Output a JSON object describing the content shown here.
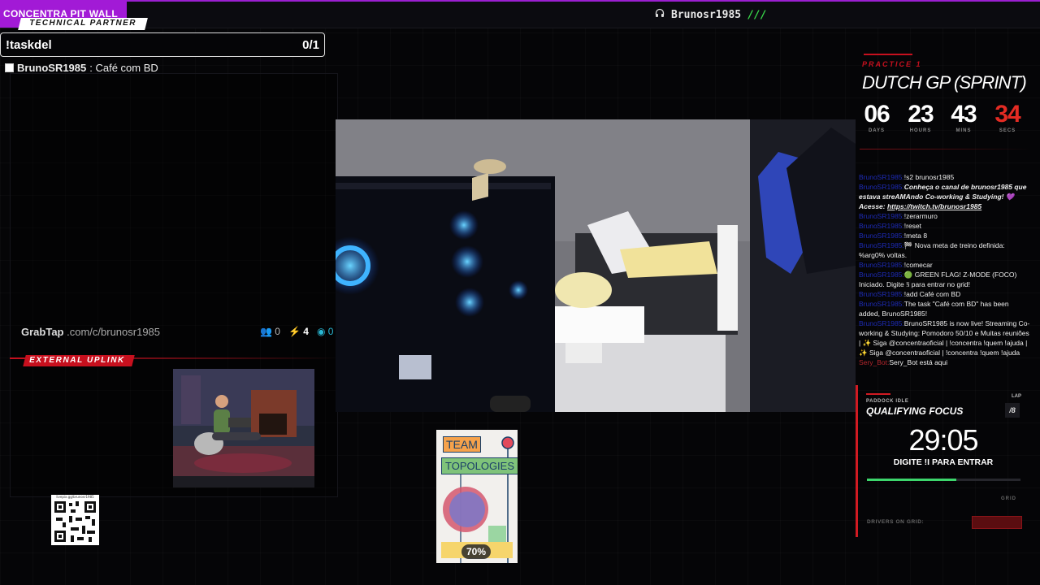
{
  "brand": {
    "title": "CONCENTRA PIT WALL"
  },
  "header": {
    "channel": "Brunosr1985",
    "slashes": "///",
    "icon": "headphones-icon"
  },
  "task_panel": {
    "label": "TECHNICAL PARTNER",
    "command": "!taskdel",
    "count": "0/1",
    "tasks": [
      {
        "user": "BrunoSR1985",
        "text": ": Café com BD"
      }
    ]
  },
  "grabtap": {
    "logo": "GrabTap",
    "url": ".com/c/brunosr1985",
    "users": "0",
    "bolts": "4",
    "viewers": "0"
  },
  "uplink": {
    "label": "EXTERNAL UPLINK"
  },
  "qr": {
    "caption": "livepix.gg/brunosr1985"
  },
  "book": {
    "title_1": "TEAM",
    "title_2": "TOPOLOGIES",
    "progress": "70%",
    "progress_value": 0.7
  },
  "race": {
    "session": "PRACTICE 1",
    "title": "DUTCH GP (SPRINT)",
    "countdown": [
      {
        "value": "06",
        "unit": "DAYS"
      },
      {
        "value": "23",
        "unit": "HOURS"
      },
      {
        "value": "43",
        "unit": "MINS"
      },
      {
        "value": "34",
        "unit": "SECS"
      }
    ]
  },
  "chat": [
    {
      "user": "BrunoSR1985:",
      "text": "!s2 brunosr1985"
    },
    {
      "user": "BrunoSR1985:",
      "text": "Conheça o canal de brunosr1985 que estava streAMAndo Co-working & Studying! 💜 ",
      "emph": true,
      "link_label": "Acesse: ",
      "link": "https://twitch.tv/brunosr1985"
    },
    {
      "user": "BrunoSR1985:",
      "text": "!zerarmuro"
    },
    {
      "user": "BrunoSR1985:",
      "text": "!reset"
    },
    {
      "user": "BrunoSR1985:",
      "text": "!meta 8"
    },
    {
      "user": "BrunoSR1985:",
      "text": "🏁 Nova meta de treino definida: %arg0% voltas."
    },
    {
      "user": "BrunoSR1985:",
      "text": "!comecar"
    },
    {
      "user": "BrunoSR1985:",
      "text": "🟢 GREEN FLAG! Z-MODE (FOCO) Iniciado. Digite !i para entrar no grid!"
    },
    {
      "user": "BrunoSR1985:",
      "text": "!add Café com BD"
    },
    {
      "user": "BrunoSR1985:",
      "text": "The task \"Café com BD\" has been added, BrunoSR1985!"
    },
    {
      "user": "BrunoSR1985:",
      "text": "BrunoSR1985 is now live! Streaming Co-working & Studying: Pomodoro 50/10 e Muitas reuniões | ✨ Siga @concentraoficial | !concentra !quem !ajuda | ✨ Siga @concentraoficial | !concentra !quem !ajuda"
    },
    {
      "user": "Sery_Bot:",
      "text": "Sery_Bot está aqui",
      "bot": true
    }
  ],
  "qualifying": {
    "status": "PADDOCK IDLE",
    "lap_label": "LAP",
    "lap": "/8",
    "title": "QUALIFYING FOCUS",
    "time": "29:05",
    "instruction": "DIGITE !I PARA ENTRAR",
    "progress": 0.58,
    "grid_label": "GRID",
    "drivers_label": "DRIVERS ON GRID:"
  },
  "colors": {
    "brand": "#a21ad6",
    "accent_red": "#d11a22",
    "green": "#3dd66c",
    "slashes": "#39d84a"
  }
}
